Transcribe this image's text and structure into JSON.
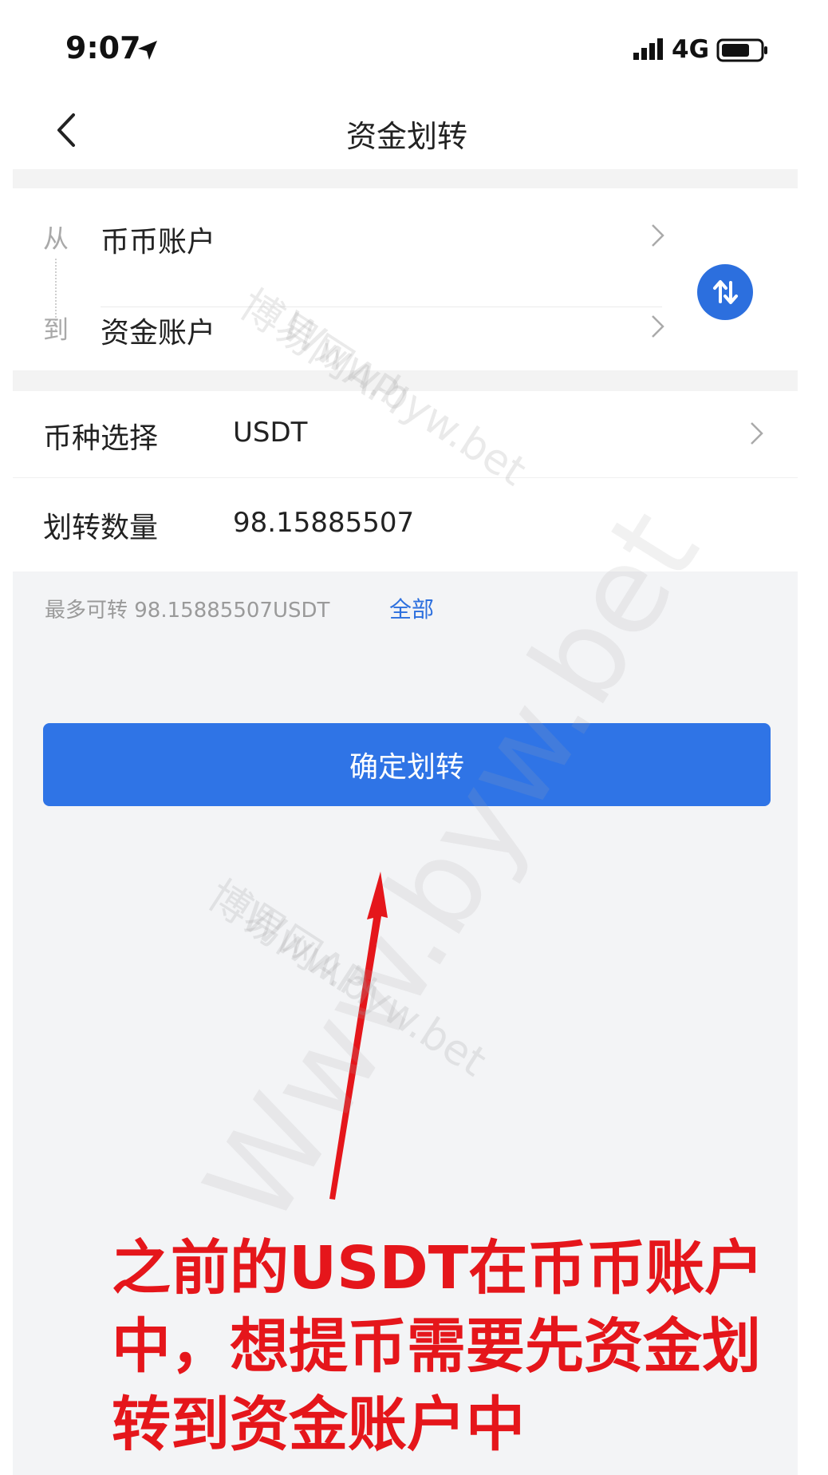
{
  "status_bar": {
    "time": "9:07",
    "network": "4G"
  },
  "nav": {
    "title": "资金划转"
  },
  "transfer": {
    "from_label": "从",
    "to_label": "到",
    "from_account": "币币账户",
    "to_account": "资金账户"
  },
  "form": {
    "currency_label": "币种选择",
    "currency_value": "USDT",
    "amount_label": "划转数量",
    "amount_value": "98.15885507",
    "max_text": "最多可转 98.15885507USDT",
    "all_label": "全部"
  },
  "confirm_button_label": "确定划转",
  "annotation": {
    "text": "之前的USDT在币币账户中，想提币需要先资金划转到资金账户中",
    "color": "#e5161b"
  },
  "watermark": {
    "line1": "博易网API",
    "line2": "Www.byw.bet",
    "large": "Www.byw.bet"
  },
  "colors": {
    "accent": "#2c6fde",
    "button": "#2f74e6"
  }
}
